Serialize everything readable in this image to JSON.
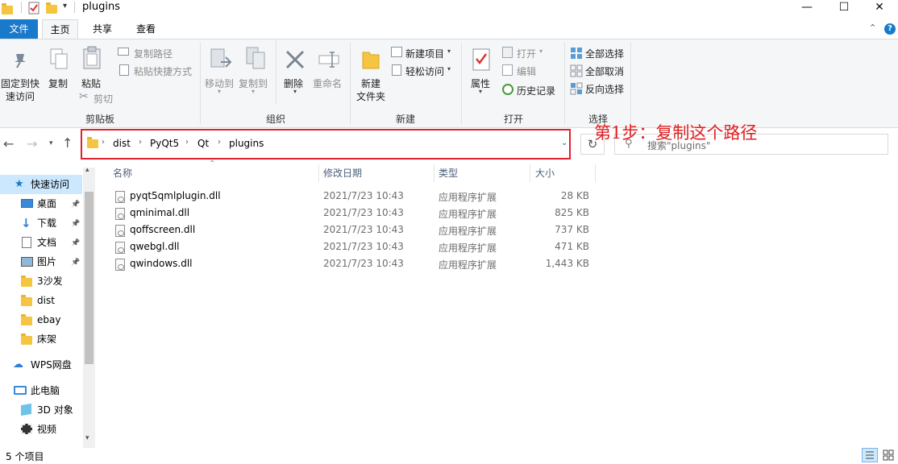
{
  "window": {
    "title": "plugins",
    "controls": {
      "minimize": "—",
      "maximize": "☐",
      "close": "✕"
    }
  },
  "ribbon_tabs": [
    "文件",
    "主页",
    "共享",
    "查看"
  ],
  "ribbon": {
    "clipboard": {
      "pin_line1": "固定到快",
      "pin_line2": "速访问",
      "copy": "复制",
      "paste": "粘贴",
      "copy_path": "复制路径",
      "paste_shortcut": "粘贴快捷方式",
      "cut": "剪切",
      "group": "剪贴板"
    },
    "organize": {
      "move_to": "移动到",
      "copy_to": "复制到",
      "delete": "删除",
      "rename": "重命名",
      "group": "组织"
    },
    "new": {
      "new_folder_line1": "新建",
      "new_folder_line2": "文件夹",
      "new_item": "新建项目",
      "easy_access": "轻松访问",
      "group": "新建"
    },
    "open": {
      "properties": "属性",
      "open": "打开",
      "edit": "编辑",
      "history": "历史记录",
      "group": "打开"
    },
    "select": {
      "select_all": "全部选择",
      "select_none": "全部取消",
      "invert": "反向选择",
      "group": "选择"
    }
  },
  "address": {
    "breadcrumbs": [
      "dist",
      "PyQt5",
      "Qt",
      "plugins"
    ],
    "search_placeholder": "搜索\"plugins\""
  },
  "annotation": "第1步：复制这个路径",
  "nav": {
    "quick_access": "快速访问",
    "items": [
      {
        "label": "桌面",
        "icon": "desktop-icon",
        "pinned": true
      },
      {
        "label": "下载",
        "icon": "download-icon",
        "pinned": true
      },
      {
        "label": "文档",
        "icon": "document-icon",
        "pinned": true
      },
      {
        "label": "图片",
        "icon": "picture-icon",
        "pinned": true
      },
      {
        "label": "3沙发",
        "icon": "folder-icon",
        "pinned": false
      },
      {
        "label": "dist",
        "icon": "folder-icon",
        "pinned": false
      },
      {
        "label": "ebay",
        "icon": "folder-icon",
        "pinned": false
      },
      {
        "label": "床架",
        "icon": "folder-icon",
        "pinned": false
      }
    ],
    "wps": "WPS网盘",
    "this_pc": "此电脑",
    "pc_items": [
      {
        "label": "3D 对象",
        "icon": "3d-objects-icon"
      },
      {
        "label": "视频",
        "icon": "video-icon"
      }
    ]
  },
  "file_list": {
    "columns": [
      "名称",
      "修改日期",
      "类型",
      "大小"
    ],
    "rows": [
      {
        "name": "pyqt5qmlplugin.dll",
        "date": "2021/7/23 10:43",
        "type": "应用程序扩展",
        "size": "28 KB"
      },
      {
        "name": "qminimal.dll",
        "date": "2021/7/23 10:43",
        "type": "应用程序扩展",
        "size": "825 KB"
      },
      {
        "name": "qoffscreen.dll",
        "date": "2021/7/23 10:43",
        "type": "应用程序扩展",
        "size": "737 KB"
      },
      {
        "name": "qwebgl.dll",
        "date": "2021/7/23 10:43",
        "type": "应用程序扩展",
        "size": "471 KB"
      },
      {
        "name": "qwindows.dll",
        "date": "2021/7/23 10:43",
        "type": "应用程序扩展",
        "size": "1,443 KB"
      }
    ]
  },
  "status": {
    "count": "5 个项目"
  },
  "colors": {
    "accent": "#1979ca",
    "highlight": "#e0202a",
    "folder": "#f5c542"
  }
}
